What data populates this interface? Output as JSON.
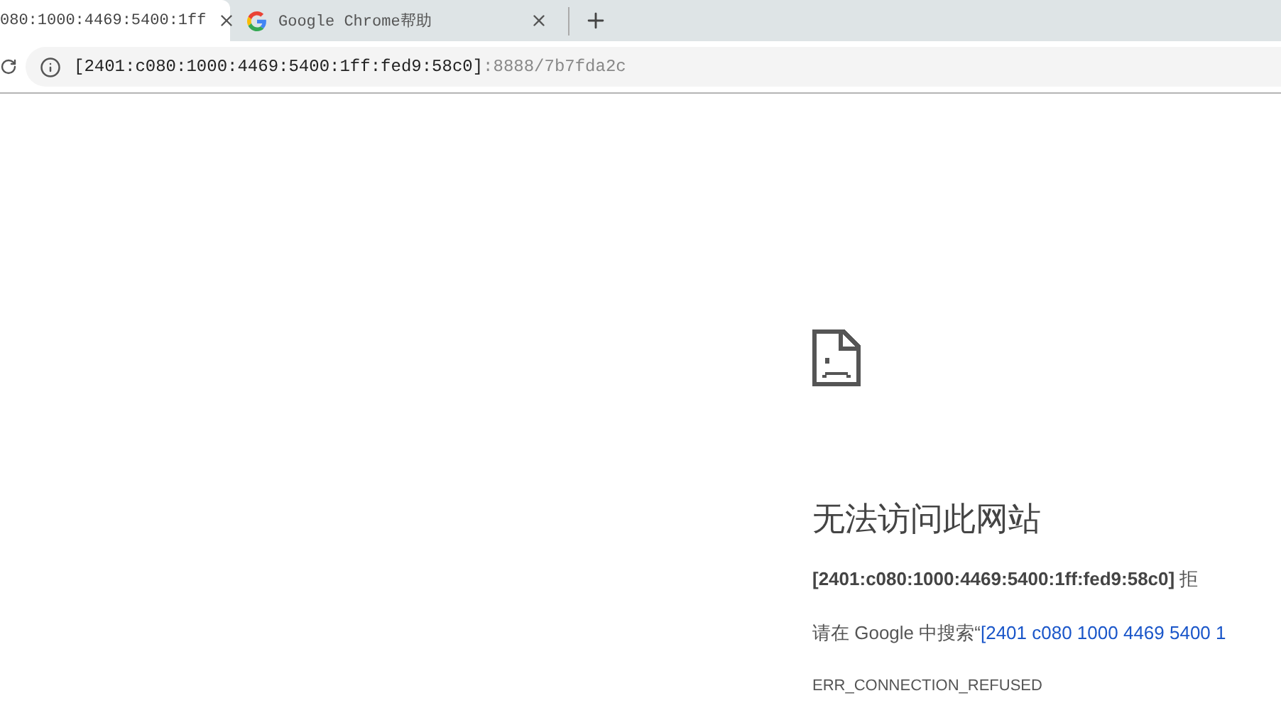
{
  "tabs": [
    {
      "kind": "plain",
      "title": "080:1000:4469:5400:1ff",
      "selected": true
    },
    {
      "kind": "favicon",
      "title": "Google Chrome帮助",
      "selected": false
    }
  ],
  "address_bar": {
    "host": "[2401:c080:1000:4469:5400:1ff:fed9:58c0]",
    "path": ":8888/7b7fda2c"
  },
  "error_page": {
    "heading": "无法访问此网站",
    "message": "**[2401:c080:1000:4469:5400:1ff:fed9:58c0]** 拒",
    "suggestion": {
      "text": "请在 Google 中搜索“",
      "link": "[2401 c080 1000 4469 5400 1"
    },
    "error_code": "ERR_CONNECTION_REFUSED"
  }
}
